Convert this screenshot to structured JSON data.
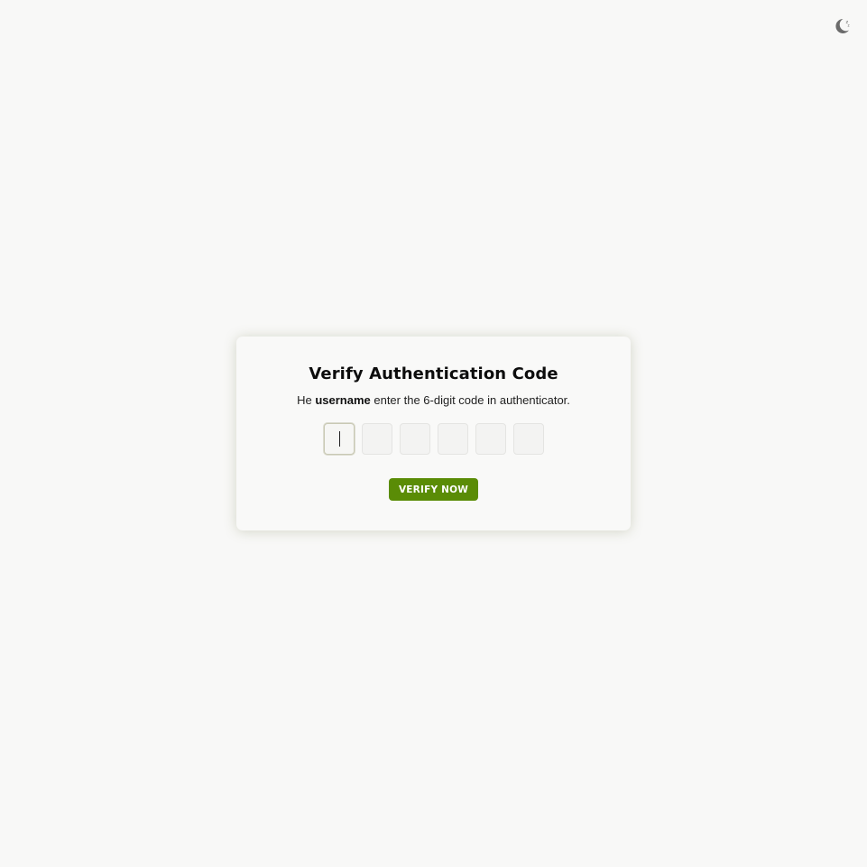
{
  "header": {
    "theme_toggle_icon": "moon-icon"
  },
  "card": {
    "title": "Verify Authentication Code",
    "subtitle_prefix": "He ",
    "subtitle_username": "username",
    "subtitle_suffix": " enter the 6-digit code in authenticator.",
    "code_length": 6,
    "code_values": [
      "",
      "",
      "",
      "",
      "",
      ""
    ],
    "verify_label": "VERIFY NOW"
  },
  "colors": {
    "background": "#f8f8f7",
    "card": "#f9f9f8",
    "accent": "#5a8c06",
    "text": "#0d0d0d"
  }
}
